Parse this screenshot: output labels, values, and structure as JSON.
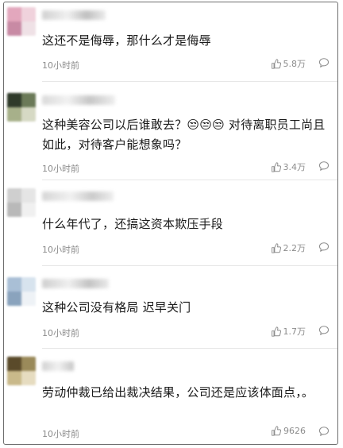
{
  "comments": [
    {
      "text": "这还不是侮辱，那什么才是侮辱",
      "time": "10小时前",
      "likes": "5.8万",
      "avatar_colors": [
        "#e3a7bd",
        "#f0d2dc",
        "#c88aa4",
        "#efe1e6"
      ]
    },
    {
      "text": "这种美容公司以后谁敢去？😒😒😒 对待离职员工尚且如此，对待客户能想象吗？",
      "time": "10小时前",
      "likes": "3.4万",
      "avatar_colors": [
        "#2f3a2a",
        "#6b7a58",
        "#a7b08a",
        "#d6d9c4"
      ]
    },
    {
      "text": "什么年代了，还搞这资本欺压手段",
      "time": "10小时前",
      "likes": "2.2万",
      "avatar_colors": [
        "#cfcfcf",
        "#e5e5e5",
        "#b9b9b9",
        "#f0f0f0"
      ]
    },
    {
      "text": "这种公司没有格局 迟早关门",
      "time": "10小时前",
      "likes": "1.7万",
      "avatar_colors": [
        "#a9bfd6",
        "#d7e3ee",
        "#8aa3bd",
        "#eef2f6"
      ]
    },
    {
      "text": "劳动仲裁已给出裁决结果，公司还是应该体面点，。",
      "time": "10小时前",
      "likes": "9626",
      "avatar_colors": [
        "#5a4a2a",
        "#9a8a5a",
        "#c9b98a",
        "#e6dcc0"
      ]
    }
  ],
  "icons": {
    "like": "thumbs-up-icon",
    "reply": "comment-bubble-icon"
  },
  "colors": {
    "text": "#1a1a1a",
    "meta": "#8c8c8c",
    "divider": "#e6e6e6",
    "border": "#6e6e6e"
  }
}
